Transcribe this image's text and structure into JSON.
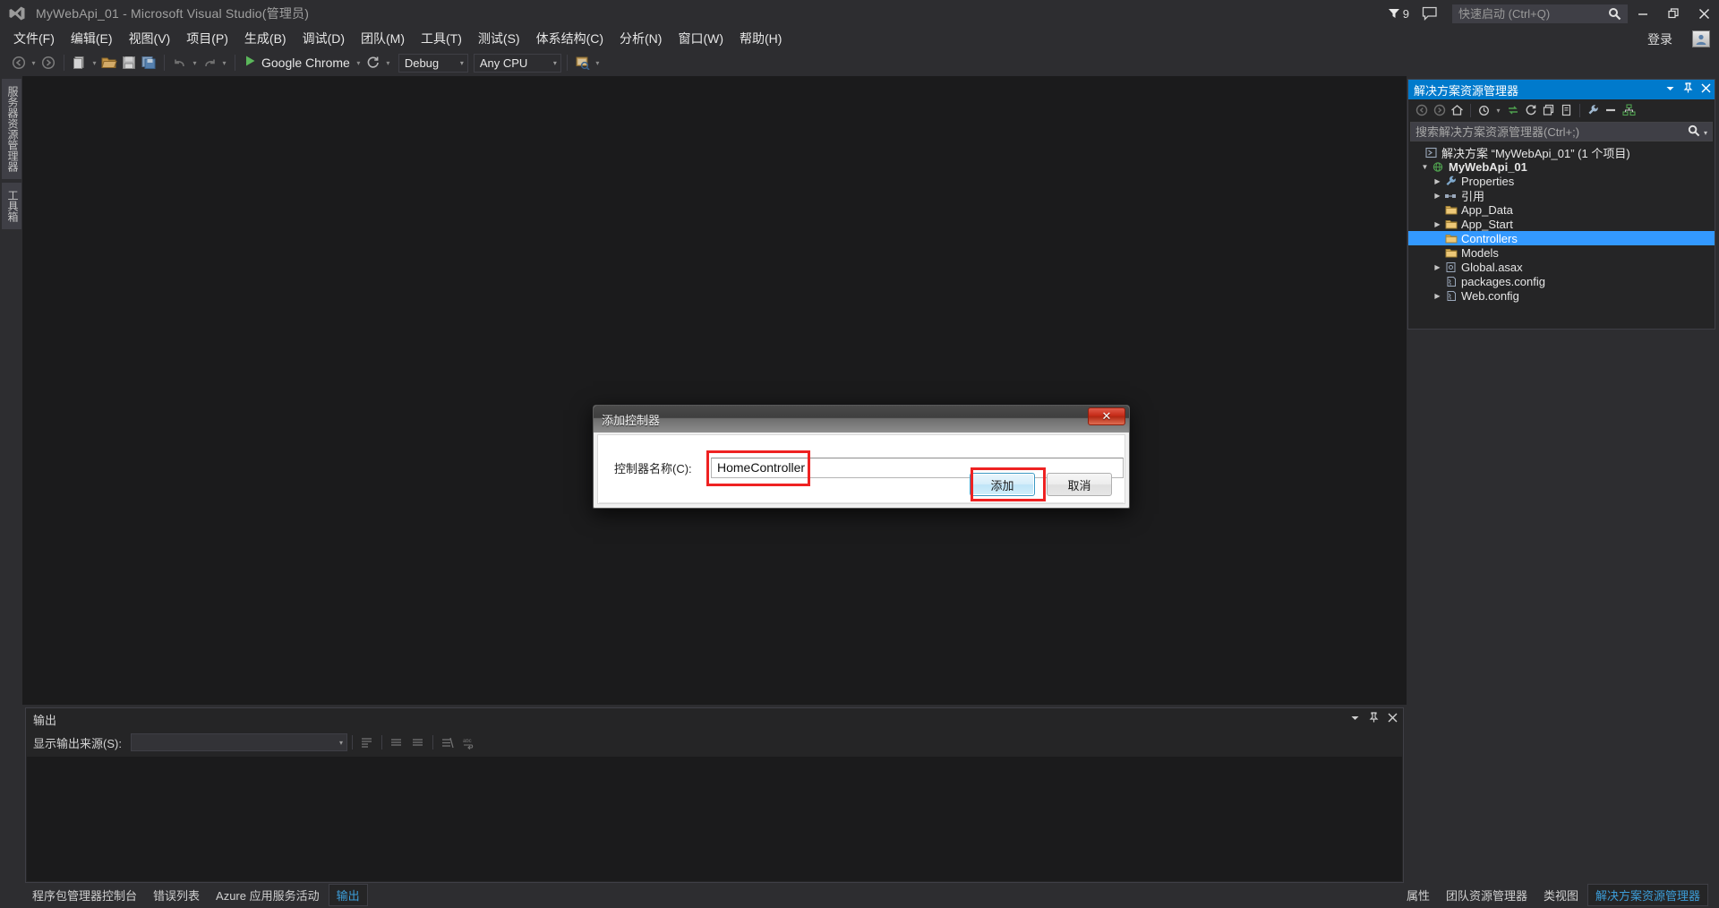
{
  "window": {
    "title": "MyWebApi_01 - Microsoft Visual Studio(管理员)",
    "logo_icon": "visual-studio-logo",
    "notification_count": "9",
    "feedback_icon": "feedback-icon",
    "minimize_label": "—",
    "restore_label": "❐",
    "close_label": "✕",
    "signin_label": "登录",
    "account_icon": "account-icon"
  },
  "quick_launch": {
    "placeholder": "快速启动 (Ctrl+Q)",
    "value": "",
    "search_icon": "search-icon"
  },
  "menu": {
    "items": [
      {
        "label": "文件(F)"
      },
      {
        "label": "编辑(E)"
      },
      {
        "label": "视图(V)"
      },
      {
        "label": "项目(P)"
      },
      {
        "label": "生成(B)"
      },
      {
        "label": "调试(D)"
      },
      {
        "label": "团队(M)"
      },
      {
        "label": "工具(T)"
      },
      {
        "label": "测试(S)"
      },
      {
        "label": "体系结构(C)"
      },
      {
        "label": "分析(N)"
      },
      {
        "label": "窗口(W)"
      },
      {
        "label": "帮助(H)"
      }
    ]
  },
  "toolbar": {
    "nav_back_icon": "navigate-back-icon",
    "nav_forward_icon": "navigate-forward-icon",
    "new_item_icon": "new-item-icon",
    "open_file_icon": "open-file-icon",
    "save_icon": "save-icon",
    "save_all_icon": "save-all-icon",
    "undo_icon": "undo-icon",
    "redo_icon": "redo-icon",
    "start_icon": "start-debug-icon",
    "start_label": "Google Chrome",
    "refresh_icon": "refresh-icon",
    "configuration": "Debug",
    "platform": "Any CPU",
    "attach_icon": "attach-to-process-icon",
    "caret": "▾"
  },
  "left_rail": {
    "tabs": [
      {
        "label": "服务器资源管理器"
      },
      {
        "label": "工具箱"
      }
    ]
  },
  "solution_explorer": {
    "title": "解决方案资源管理器",
    "dropdown_icon": "chevron-down-icon",
    "pin_icon": "pin-icon",
    "close_icon": "close-icon",
    "toolbar_icons": [
      "back-icon",
      "forward-icon",
      "home-icon",
      "pending-changes-icon",
      "sync-with-active-document-icon",
      "refresh-icon",
      "collapse-all-icon",
      "show-all-files-icon",
      "properties-icon",
      "preview-selected-items-icon",
      "view-class-diagram-icon"
    ],
    "search_placeholder": "搜索解决方案资源管理器(Ctrl+;)",
    "search_value": "",
    "search_icon": "search-icon",
    "search_dropdown_icon": "chevron-down-icon",
    "tree": [
      {
        "label": "解决方案 “MyWebApi_01” (1 个项目)",
        "icon": "solution-icon",
        "indent": 0,
        "arrow": "",
        "bold": false,
        "selected": false
      },
      {
        "label": "MyWebApi_01",
        "icon": "web-project-icon",
        "indent": 1,
        "arrow": "▼",
        "bold": true,
        "selected": false
      },
      {
        "label": "Properties",
        "icon": "properties-wrench-icon",
        "indent": 2,
        "arrow": "▶",
        "bold": false,
        "selected": false
      },
      {
        "label": "引用",
        "icon": "references-icon",
        "indent": 2,
        "arrow": "▶",
        "bold": false,
        "selected": false
      },
      {
        "label": "App_Data",
        "icon": "folder-icon",
        "indent": 2,
        "arrow": "",
        "bold": false,
        "selected": false
      },
      {
        "label": "App_Start",
        "icon": "folder-icon",
        "indent": 2,
        "arrow": "▶",
        "bold": false,
        "selected": false
      },
      {
        "label": "Controllers",
        "icon": "folder-icon",
        "indent": 2,
        "arrow": "",
        "bold": false,
        "selected": true
      },
      {
        "label": "Models",
        "icon": "folder-icon",
        "indent": 2,
        "arrow": "",
        "bold": false,
        "selected": false
      },
      {
        "label": "Global.asax",
        "icon": "asax-file-icon",
        "indent": 2,
        "arrow": "▶",
        "bold": false,
        "selected": false
      },
      {
        "label": "packages.config",
        "icon": "config-file-icon",
        "indent": 2,
        "arrow": "",
        "bold": false,
        "selected": false
      },
      {
        "label": "Web.config",
        "icon": "config-file-icon",
        "indent": 2,
        "arrow": "▶",
        "bold": false,
        "selected": false
      }
    ],
    "bottom_tabs": [
      {
        "label": "属性",
        "active": false
      },
      {
        "label": "团队资源管理器",
        "active": false
      },
      {
        "label": "类视图",
        "active": false
      },
      {
        "label": "解决方案资源管理器",
        "active": true
      }
    ]
  },
  "output_panel": {
    "title": "输出",
    "dropdown_icon": "chevron-down-icon",
    "pin_icon": "pin-icon",
    "close_icon": "close-icon",
    "source_label": "显示输出来源(S):",
    "source_value": "",
    "source_caret": "▾",
    "toolbar_icons": [
      "find-message-icon",
      "clear-all-icon",
      "go-to-previous-message-icon",
      "go-to-next-message-icon",
      "toggle-word-wrap-icon"
    ],
    "body_text": ""
  },
  "bottom_tabs": [
    {
      "label": "程序包管理器控制台",
      "active": false
    },
    {
      "label": "错误列表",
      "active": false
    },
    {
      "label": "Azure 应用服务活动",
      "active": false
    },
    {
      "label": "输出",
      "active": true
    }
  ],
  "dialog": {
    "title": "添加控制器",
    "close_label": "✕",
    "field_label": "控制器名称(C):",
    "field_value": "HomeController",
    "field_placeholder": "",
    "add_button": "添加",
    "cancel_button": "取消",
    "annotation_color": "#ee2222"
  },
  "colors": {
    "accent": "#007acc",
    "selection": "#3399ff",
    "chrome": "#2d2d30",
    "panel": "#252526",
    "editor": "#1b1b1c",
    "annotation": "#ee2222"
  }
}
